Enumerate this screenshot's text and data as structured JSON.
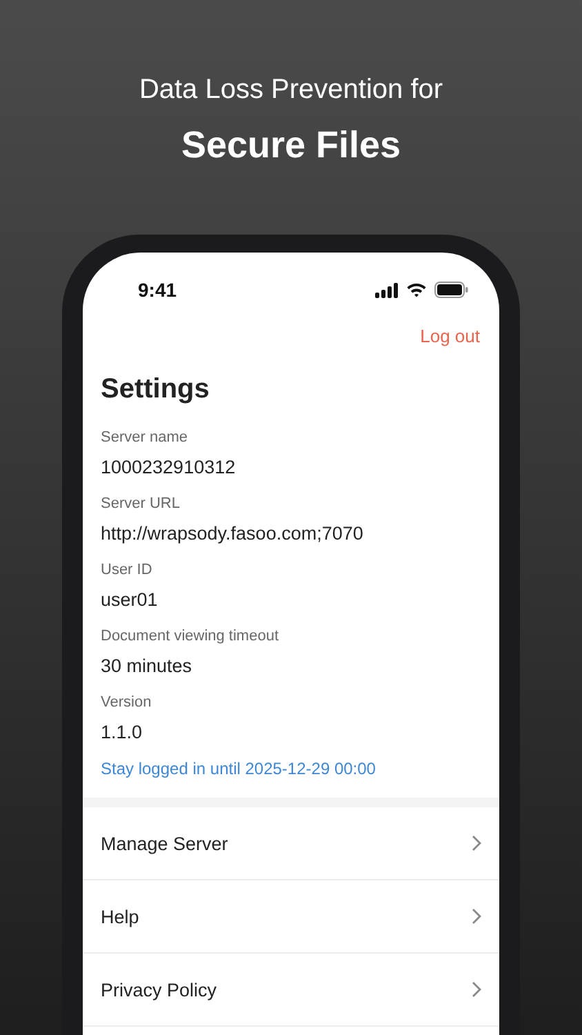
{
  "headline": {
    "line_1": "Data Loss Prevention for",
    "line_2": "Secure Files"
  },
  "status_bar": {
    "time": "9:41"
  },
  "logout": "Log out",
  "title": "Settings",
  "fields": [
    {
      "label": "Server name",
      "value": "1000232910312"
    },
    {
      "label": "Server URL",
      "value": "http://wrapsody.fasoo.com;7070"
    },
    {
      "label": "User ID",
      "value": "user01"
    },
    {
      "label": "Document viewing timeout",
      "value": "30 minutes"
    },
    {
      "label": "Version",
      "value": "1.1.0"
    }
  ],
  "session_note": "Stay logged in until 2025-12-29 00:00",
  "menu": [
    {
      "label": "Manage Server"
    },
    {
      "label": "Help"
    },
    {
      "label": "Privacy Policy"
    }
  ]
}
